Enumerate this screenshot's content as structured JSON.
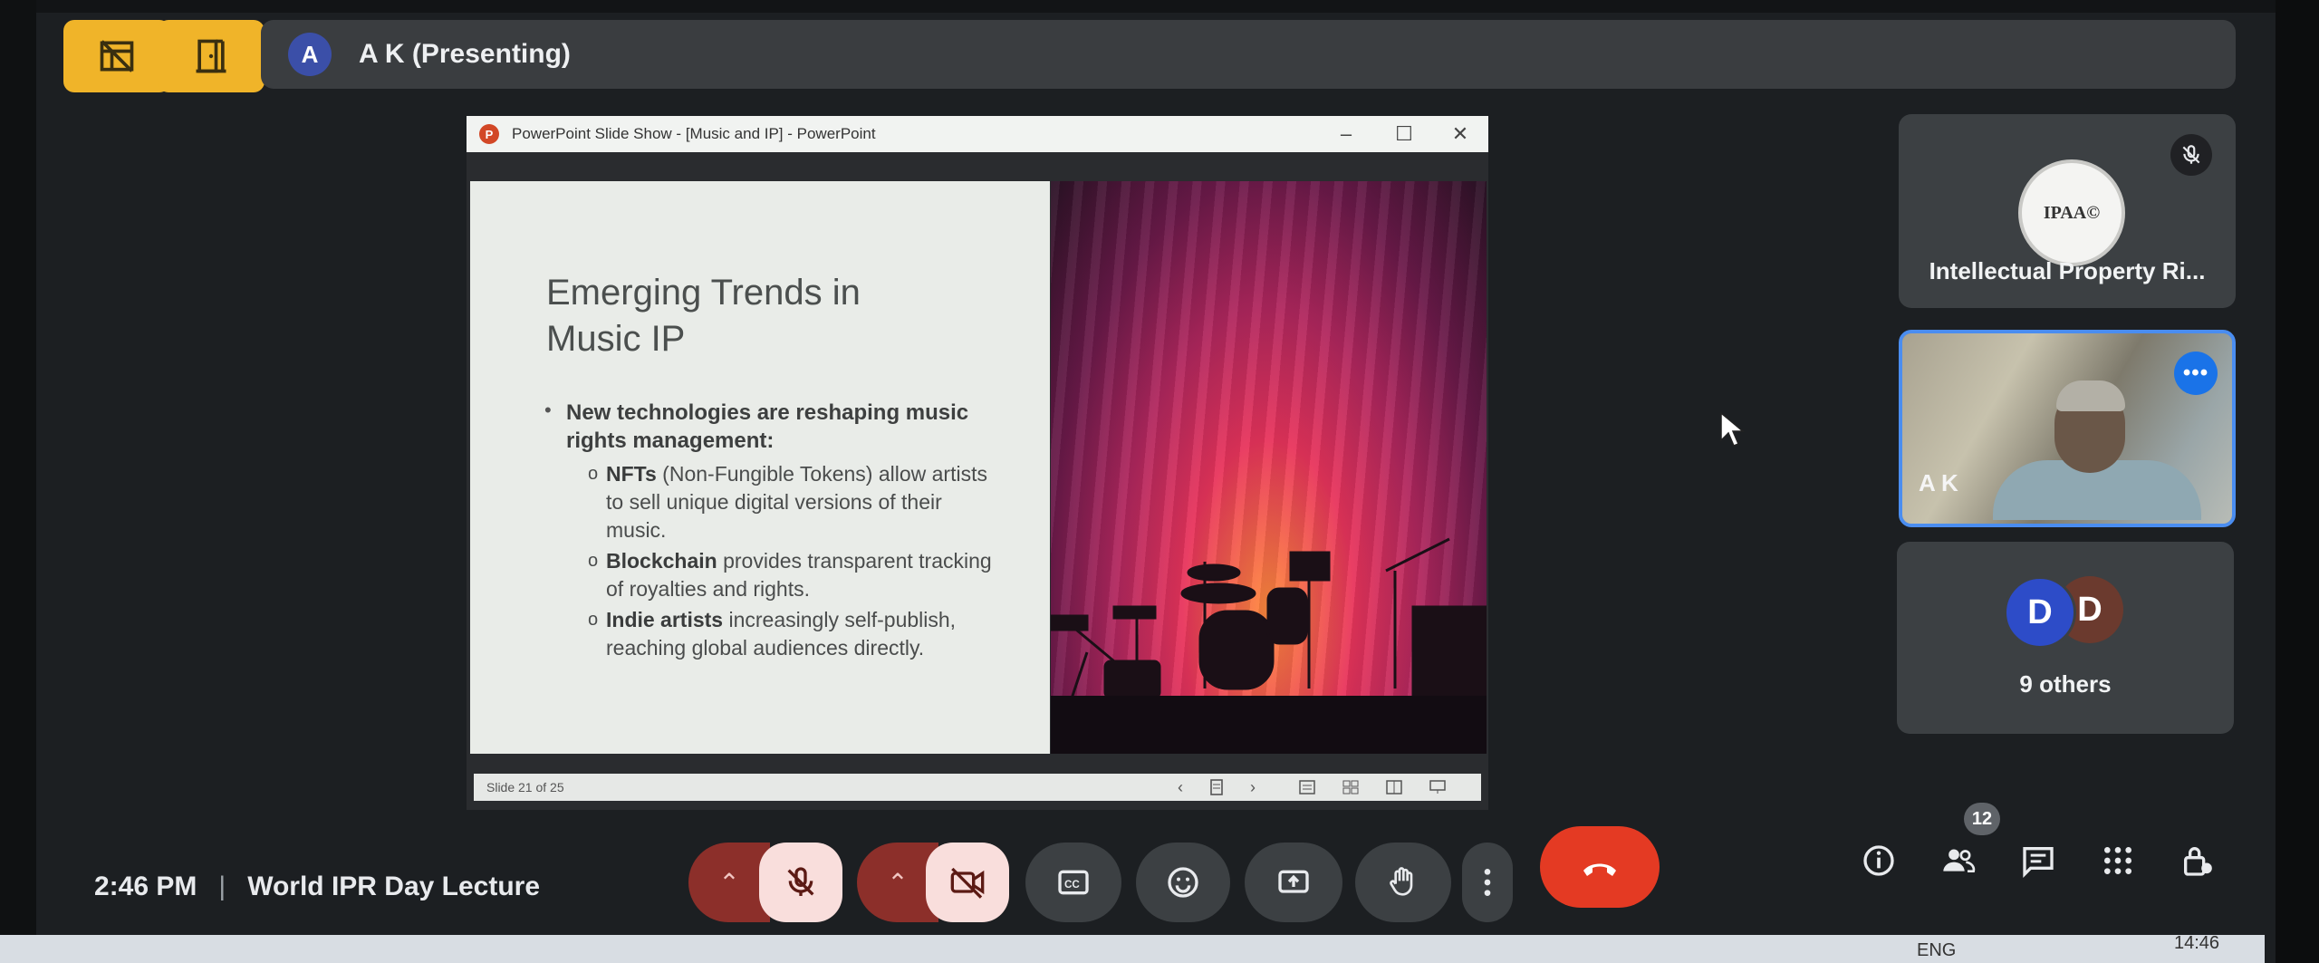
{
  "presenter_bar": {
    "avatar_initial": "A",
    "name": "A K (Presenting)"
  },
  "top_buttons": [
    {
      "icon": "layout-off-icon"
    },
    {
      "icon": "door-exit-icon"
    }
  ],
  "powerpoint": {
    "window_title": "PowerPoint Slide Show - [Music and IP] - PowerPoint",
    "logo_letter": "P",
    "controls": {
      "minimize": "–",
      "maximize": "☐",
      "close": "✕"
    },
    "slide": {
      "title_line1": "Emerging Trends in",
      "title_line2": "Music IP",
      "main_bullet": "New technologies are reshaping music rights management:",
      "sub_bullets": [
        {
          "bold": "NFTs",
          "text": " (Non-Fungible Tokens) allow artists to sell unique digital versions of their music."
        },
        {
          "bold": "Blockchain",
          "text": " provides transparent tracking of royalties and rights."
        },
        {
          "bold": "Indie artists",
          "text": " increasingly self-publish, reaching global audiences directly."
        }
      ]
    },
    "status": {
      "slide_counter": "Slide 21 of 25",
      "prev": "‹",
      "next": "›"
    }
  },
  "participants": {
    "org_tile": {
      "logo_text": "IPAA©",
      "name": "Intellectual Property Ri...",
      "mic": "muted"
    },
    "speaker_tile": {
      "label": "A K",
      "more": "•••"
    },
    "others_tile": {
      "avatars": [
        "D",
        "D"
      ],
      "label": "9 others"
    }
  },
  "bottom_bar": {
    "time": "2:46 PM",
    "separator": "|",
    "meeting_title": "World IPR Day Lecture",
    "people_count": "12",
    "caret": "⌃"
  },
  "taskbar": {
    "language": "ENG",
    "time": "14:46"
  },
  "colors": {
    "accent_yellow": "#f0b429",
    "leave_red": "#e43a23",
    "active_blue": "#4a8df0",
    "avatar_blue": "#3b4fa8"
  }
}
